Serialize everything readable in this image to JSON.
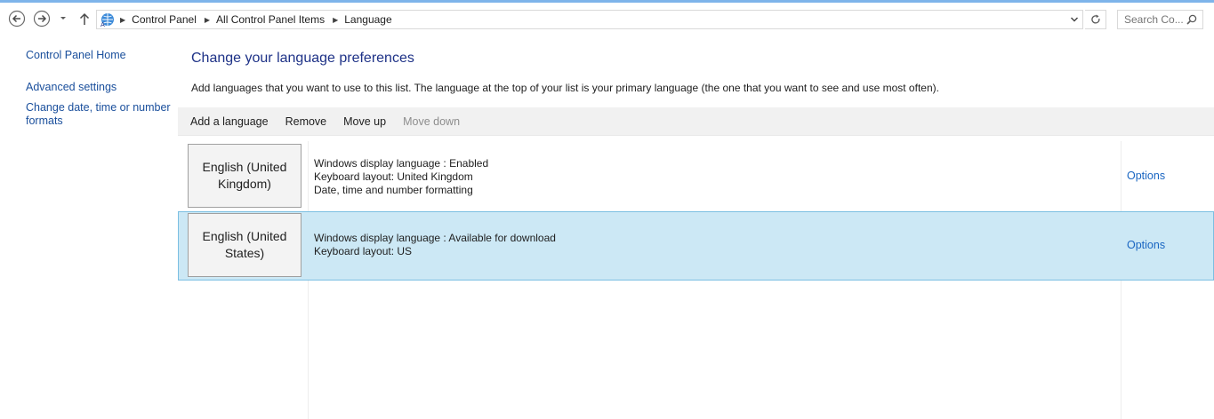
{
  "address_bar": {
    "breadcrumbs": [
      "Control Panel",
      "All Control Panel Items",
      "Language"
    ]
  },
  "search": {
    "placeholder": "Search Co..."
  },
  "left_nav": {
    "home": "Control Panel Home",
    "advanced": "Advanced settings",
    "date_formats": "Change date, time or number formats"
  },
  "main": {
    "title": "Change your language preferences",
    "description": "Add languages that you want to use to this list. The language at the top of your list is your primary language (the one that you want to see and use most often)."
  },
  "toolbar": {
    "add": "Add a language",
    "remove": "Remove",
    "move_up": "Move up",
    "move_down": "Move down"
  },
  "languages": [
    {
      "name": "English (United Kingdom)",
      "details": [
        "Windows display language : Enabled",
        "Keyboard layout: United Kingdom",
        "Date, time and number formatting"
      ],
      "options": "Options",
      "selected": false
    },
    {
      "name": "English (United States)",
      "details": [
        "Windows display language : Available for download",
        "Keyboard layout: US"
      ],
      "options": "Options",
      "selected": true
    }
  ],
  "colors": {
    "accent_bar": "#7eb4ea",
    "link": "#1a4f9c",
    "title": "#1e3287",
    "selection_bg": "#cce8f5",
    "selection_border": "#7bbfe2"
  },
  "icons": [
    "back-arrow-icon",
    "forward-arrow-icon",
    "chevron-down-icon",
    "up-arrow-icon",
    "control-panel-icon",
    "refresh-icon",
    "search-icon"
  ]
}
